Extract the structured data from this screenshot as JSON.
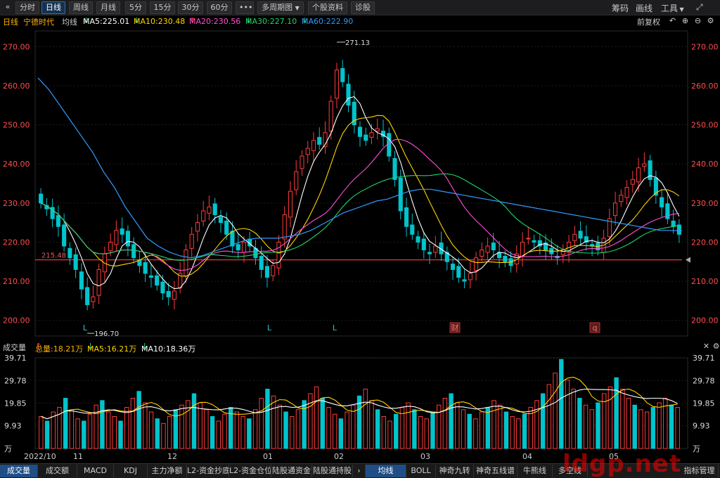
{
  "toolbar": {
    "back_icon": "«",
    "periods": [
      "分时",
      "日线",
      "周线",
      "月线",
      "5分",
      "15分",
      "30分",
      "60分"
    ],
    "active_period": "日线",
    "more": "•••",
    "multi_period": "多周期图",
    "stock_info": "个股资料",
    "diagnose": "诊股",
    "right_items": [
      "筹码",
      "画线",
      "工具"
    ],
    "expand_icon": "⤢"
  },
  "info": {
    "period": "日线",
    "stock": "宁德时代",
    "ma_label": "均线",
    "ma5": "MA5:225.01",
    "ma10": "MA10:230.48",
    "ma20": "MA20:230.56",
    "ma30": "MA30:227.10",
    "ma60": "MA60:222.90",
    "adjust": "前复权"
  },
  "colors": {
    "up": "#ff3b3b",
    "down": "#00c4cc",
    "ma5": "#ffffff",
    "ma10": "#ffd400",
    "ma20": "#ff4fd8",
    "ma30": "#22d36b",
    "ma60": "#2f9bff",
    "axis_text": "#ff4d4d",
    "support_line": "#e23b3b",
    "volume_axis_text": "#dddddd"
  },
  "price_axis": [
    "270.00",
    "260.00",
    "250.00",
    "240.00",
    "230.00",
    "220.00",
    "210.00",
    "200.00"
  ],
  "price_annotations": {
    "high": "271.13",
    "low": "196.70",
    "support": "215.48"
  },
  "markers": [
    "L",
    "L",
    "L",
    "财",
    "q"
  ],
  "volume": {
    "title": "成交量",
    "total": "总量:18.21万",
    "ma5": "MA5:16.21万",
    "ma10": "MA10:18.36万",
    "axis": [
      "39.71",
      "29.78",
      "19.85",
      "9.93",
      "万"
    ]
  },
  "date_axis": [
    "2022/10",
    "11",
    "12",
    "01",
    "02",
    "03",
    "04",
    "05"
  ],
  "bottom_tabs": [
    "成交量",
    "成交额",
    "MACD",
    "KDJ",
    "主力净额",
    "L2-资金抄底",
    "L2-资金仓位",
    "陆股通资金",
    "陆股通持股",
    "›",
    "均线",
    "BOLL",
    "神奇九转",
    "神奇五线谱",
    "牛熊线",
    "多空线",
    "指标管理"
  ],
  "watermark": "ldgp.net",
  "chart_data": {
    "type": "candlestick",
    "title": "宁德时代 日线",
    "ylim": [
      196,
      274
    ],
    "x_ticks": [
      "2022/10",
      "11",
      "12",
      "01",
      "02",
      "03",
      "04",
      "05"
    ],
    "ma_latest": {
      "MA5": 225.01,
      "MA10": 230.48,
      "MA20": 230.56,
      "MA30": 227.1,
      "MA60": 222.9
    },
    "volume_latest": {
      "total_wan": 18.21,
      "MA5_wan": 16.21,
      "MA10_wan": 18.36
    },
    "volume_ylim_wan": [
      0,
      39.71
    ],
    "support_level": 215.48,
    "period_high": 271.13,
    "period_low": 196.7,
    "close_series_approx": [
      230.0,
      228.5,
      226.0,
      224.0,
      219.0,
      216.0,
      213.0,
      208.0,
      204.0,
      206.0,
      213.0,
      217.0,
      220.0,
      223.0,
      222.0,
      219.0,
      216.0,
      214.0,
      212.0,
      211.0,
      209.0,
      207.0,
      206.0,
      207.5,
      212.0,
      218.0,
      222.0,
      225.0,
      228.0,
      229.0,
      227.0,
      225.0,
      222.0,
      219.0,
      218.0,
      220.0,
      219.0,
      216.0,
      213.0,
      211.0,
      214.0,
      220.0,
      227.0,
      233.0,
      238.0,
      242.0,
      244.0,
      246.0,
      245.0,
      248.0,
      256.0,
      264.0,
      261.0,
      255.0,
      250.0,
      247.0,
      246.0,
      248.0,
      249.0,
      247.0,
      242.0,
      236.0,
      228.0,
      224.0,
      222.0,
      220.0,
      218.0,
      217.0,
      219.0,
      217.0,
      215.0,
      213.0,
      211.0,
      210.0,
      212.0,
      216.0,
      218.0,
      219.0,
      218.0,
      216.0,
      215.0,
      214.0,
      217.0,
      220.0,
      221.0,
      220.0,
      219.0,
      218.0,
      217.0,
      216.0,
      218.0,
      220.0,
      222.0,
      221.0,
      220.0,
      219.0,
      218.0,
      221.0,
      226.0,
      230.0,
      232.0,
      234.0,
      236.0,
      239.0,
      240.0,
      236.0,
      232.0,
      229.0,
      226.0,
      224.0,
      222.0
    ],
    "ma60_series_approx": [
      262.0,
      259.0,
      255.0,
      251.0,
      247.0,
      243.0,
      238.0,
      234.0,
      229.0,
      225.0,
      221.0,
      219.0,
      217.5,
      216.5,
      216.0,
      216.5,
      217.5,
      218.5,
      219.5,
      220.5,
      221.0,
      221.0,
      221.0,
      221.5,
      222.0,
      223.0,
      224.5,
      226.0,
      227.5,
      228.5,
      229.5,
      230.5,
      231.0,
      232.0,
      233.0,
      233.5,
      233.5,
      233.0,
      232.5,
      232.0,
      231.5,
      231.0,
      230.5,
      230.0,
      229.5,
      229.0,
      228.5,
      228.0,
      227.5,
      227.0,
      226.5,
      226.0,
      225.5,
      225.0,
      224.5,
      224.0,
      223.5,
      223.0,
      223.0,
      222.9
    ],
    "volume_series_wan": [
      14,
      12,
      16,
      18,
      22,
      17,
      13,
      12,
      15,
      19,
      21,
      16,
      14,
      12,
      18,
      22,
      25,
      20,
      16,
      13,
      11,
      14,
      17,
      19,
      21,
      24,
      20,
      17,
      14,
      12,
      15,
      18,
      16,
      14,
      13,
      17,
      22,
      26,
      23,
      19,
      16,
      14,
      17,
      21,
      24,
      27,
      22,
      18,
      15,
      13,
      16,
      19,
      23,
      26,
      21,
      17,
      14,
      12,
      15,
      18,
      20,
      17,
      14,
      13,
      16,
      19,
      22,
      24,
      20,
      17,
      15,
      13,
      16,
      18,
      21,
      19,
      16,
      14,
      13,
      15,
      18,
      21,
      24,
      28,
      33,
      39,
      30,
      26,
      22,
      19,
      17,
      20,
      24,
      27,
      31,
      26,
      22,
      19,
      17,
      16,
      18,
      20,
      22,
      19,
      18
    ]
  }
}
